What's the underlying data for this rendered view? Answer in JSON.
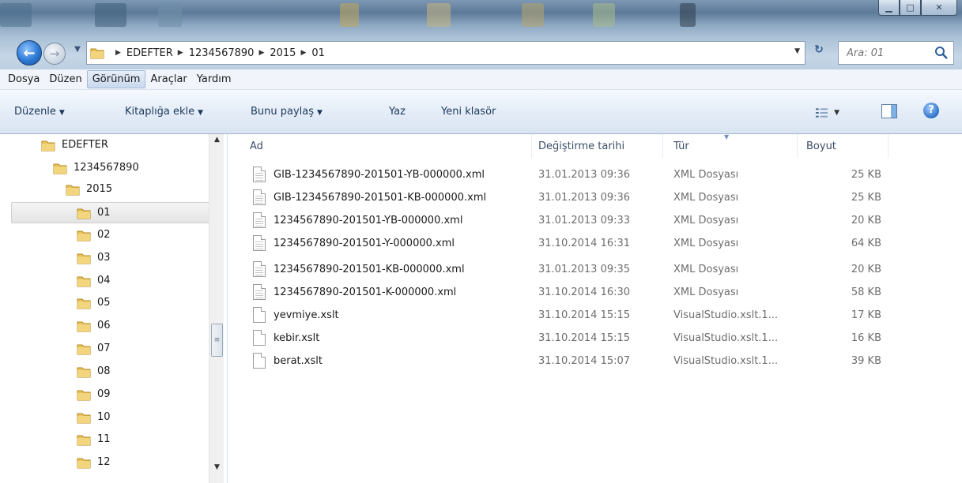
{
  "window": {
    "controls": {
      "minimize": "▁",
      "maximize": "□",
      "close": "✕"
    }
  },
  "nav": {
    "back_icon": "back-arrow-icon",
    "forward_icon": "forward-arrow-icon",
    "breadcrumb": [
      "EDEFTER",
      "1234567890",
      "2015",
      "01"
    ],
    "search_placeholder": "Ara: 01"
  },
  "menu": [
    "Dosya",
    "Düzen",
    "Görünüm",
    "Araçlar",
    "Yardım"
  ],
  "menu_active": "Görünüm",
  "commands": {
    "organize": "Düzenle",
    "include_library": "Kitaplığa ekle",
    "share_with": "Bunu paylaş",
    "burn": "Yaz",
    "new_folder": "Yeni klasör"
  },
  "tree": {
    "root": "EDEFTER",
    "company": "1234567890",
    "year": "2015",
    "months": [
      "01",
      "02",
      "03",
      "04",
      "05",
      "06",
      "07",
      "08",
      "09",
      "10",
      "11",
      "12"
    ],
    "selected": "01"
  },
  "columns": {
    "name": "Ad",
    "modified": "Değiştirme tarihi",
    "type": "Tür",
    "size": "Boyut"
  },
  "files": [
    {
      "name": "GIB-1234567890-201501-YB-000000.xml",
      "modified": "31.01.2013 09:36",
      "type": "XML Dosyası",
      "size": "25 KB",
      "icon": "xml"
    },
    {
      "name": "GIB-1234567890-201501-KB-000000.xml",
      "modified": "31.01.2013 09:36",
      "type": "XML Dosyası",
      "size": "25 KB",
      "icon": "xml"
    },
    {
      "name": "1234567890-201501-YB-000000.xml",
      "modified": "31.01.2013 09:33",
      "type": "XML Dosyası",
      "size": "20 KB",
      "icon": "xml"
    },
    {
      "name": "1234567890-201501-Y-000000.xml",
      "modified": "31.10.2014 16:31",
      "type": "XML Dosyası",
      "size": "64 KB",
      "icon": "xml"
    },
    {
      "name": "1234567890-201501-KB-000000.xml",
      "modified": "31.01.2013 09:35",
      "type": "XML Dosyası",
      "size": "20 KB",
      "icon": "xml"
    },
    {
      "name": "1234567890-201501-K-000000.xml",
      "modified": "31.10.2014 16:30",
      "type": "XML Dosyası",
      "size": "58 KB",
      "icon": "xml"
    },
    {
      "name": "yevmiye.xslt",
      "modified": "31.10.2014 15:15",
      "type": "VisualStudio.xslt.1...",
      "size": "17 KB",
      "icon": "plain"
    },
    {
      "name": "kebir.xslt",
      "modified": "31.10.2014 15:15",
      "type": "VisualStudio.xslt.1...",
      "size": "16 KB",
      "icon": "plain"
    },
    {
      "name": "berat.xslt",
      "modified": "31.10.2014 15:07",
      "type": "VisualStudio.xslt.1...",
      "size": "39 KB",
      "icon": "plain"
    }
  ]
}
